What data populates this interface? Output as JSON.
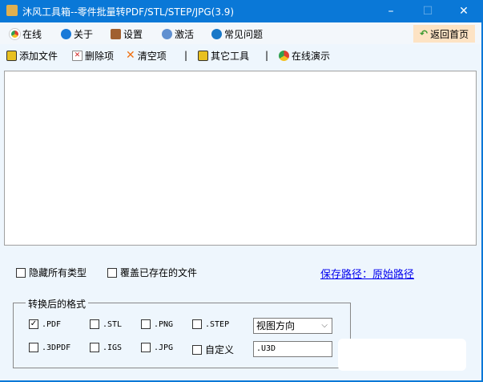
{
  "window": {
    "title": "沐风工具箱--零件批量转PDF/STL/STEP/JPG(3.9)",
    "minimize": "–",
    "maximize": "☐",
    "close": "✕"
  },
  "menu": [
    {
      "label": "在线",
      "icon": "chrome-icon",
      "color": "#e04030"
    },
    {
      "label": "关于",
      "icon": "info-icon",
      "color": "#1a7ad8"
    },
    {
      "label": "设置",
      "icon": "tools-icon",
      "color": "#a06030"
    },
    {
      "label": "激活",
      "icon": "key-icon",
      "color": "#6090d0"
    },
    {
      "label": "常见问题",
      "icon": "help-icon",
      "color": "#1878c8"
    }
  ],
  "home_button": {
    "label": "返回首页",
    "icon": "back-arrow-icon"
  },
  "toolbar": [
    {
      "label": "添加文件",
      "icon": "add-file-icon"
    },
    {
      "label": "删除项",
      "icon": "delete-file-icon"
    },
    {
      "label": "清空项",
      "icon": "clear-x-icon"
    },
    {
      "label": "其它工具",
      "icon": "tools-icon"
    },
    {
      "label": "在线演示",
      "icon": "chrome-icon"
    }
  ],
  "separator": "|",
  "options": {
    "hide_types": "隐藏所有类型",
    "overwrite": "覆盖已存在的文件",
    "save_path": "保存路径：原始路径"
  },
  "format_group": {
    "label": "转换后的格式",
    "formats": [
      {
        "label": ".PDF",
        "checked": true,
        "mark": "✓"
      },
      {
        "label": ".STL",
        "checked": false
      },
      {
        "label": ".PNG",
        "checked": false
      },
      {
        "label": ".STEP",
        "checked": false
      },
      {
        "label": ".3DPDF",
        "checked": false
      },
      {
        "label": ".IGS",
        "checked": false
      },
      {
        "label": ".JPG",
        "checked": false
      },
      {
        "label": "自定义",
        "checked": false
      }
    ],
    "view_select": "视图方向",
    "custom_ext": ".U3D"
  }
}
